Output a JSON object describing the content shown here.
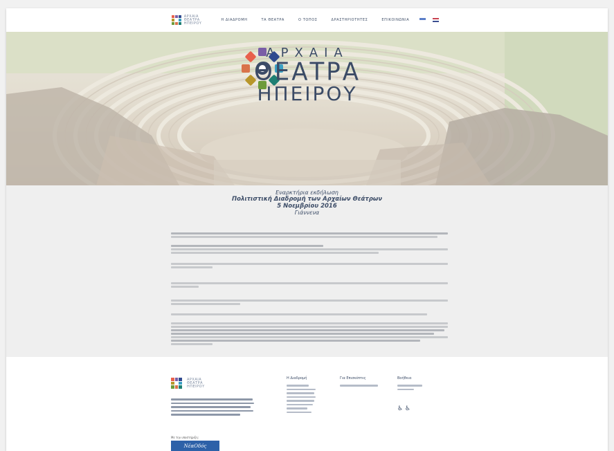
{
  "nav": {
    "brand_lines": [
      "ΑΡΧΑΙΑ",
      "ΘΕΑΤΡΑ",
      "ΗΠΕΙΡΟΥ"
    ],
    "links": [
      "Η ΔΙΑΔΡΟΜΗ",
      "ΤΑ ΘΕΑΤΡΑ",
      "Ο ΤΟΠΟΣ",
      "ΔΡΑΣΤΗΡΙΟΤΗΤΕΣ",
      "ΕΠΙΚΟΙΝΩΝΙΑ"
    ],
    "languages": [
      "el",
      "en"
    ]
  },
  "hero": {
    "logo_line1": "ΑΡΧΑΙΑ",
    "logo_line2": "ΘΕΑΤΡΑ",
    "logo_line3": "ΗΠΕΙΡΟΥ",
    "logo_colors": [
      "#e8614c",
      "#7a5ea6",
      "#2f4a8f",
      "#3aa0c4",
      "#1e7f73",
      "#6d9b3a",
      "#b8962a",
      "#d9734a"
    ]
  },
  "intro": {
    "line1": "Εναρκτήρια εκδήλωση",
    "line2": "Πολιτιστική Διαδρομή των Αρχαίων Θεάτρων",
    "line3": "5 Νοεμβρίου 2016",
    "line4": "Γιάννενα"
  },
  "footer": {
    "logo_lines": [
      "ΑΡΧΑΙΑ",
      "ΘΕΑΤΡΑ",
      "ΗΠΕΙΡΟΥ"
    ],
    "col1_head": "Η Διαδρομή",
    "col2_head": "Για Επισκέπτες",
    "col3_head": "Βοήθεια",
    "accessibility": "♿ ♿",
    "sponsor_label": "Με την υποστήριξη:",
    "sponsor_name": "ΝέαΟδός"
  },
  "colors": {
    "navy": "#3b4b66",
    "content_bg": "#efefef"
  }
}
